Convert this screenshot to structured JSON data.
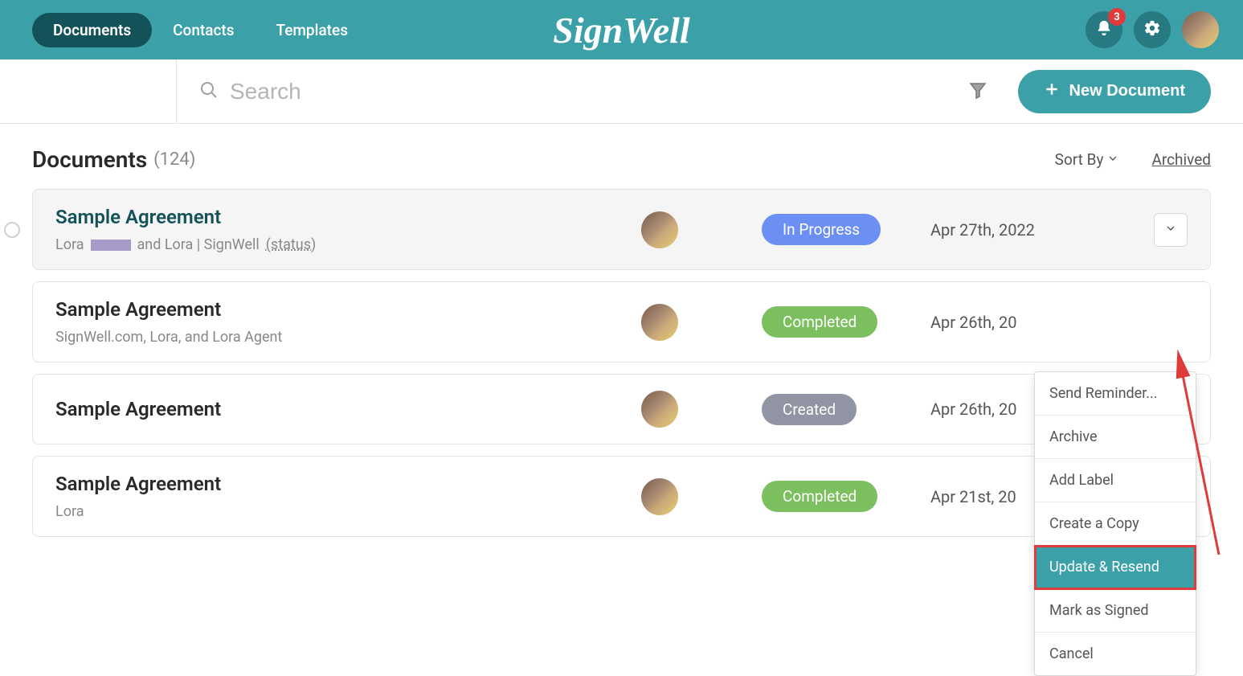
{
  "nav": {
    "items": [
      {
        "label": "Documents",
        "active": true
      },
      {
        "label": "Contacts",
        "active": false
      },
      {
        "label": "Templates",
        "active": false
      }
    ],
    "logo": "SignWell",
    "notifications_count": "3"
  },
  "search": {
    "placeholder": "Search",
    "new_button": "New Document"
  },
  "page": {
    "title": "Documents",
    "count": "(124)",
    "sort_label": "Sort By",
    "archived_label": "Archived"
  },
  "documents": [
    {
      "title": "Sample Agreement",
      "sub_prefix": "Lora",
      "sub_suffix": " and Lora | SignWell ",
      "status_link": "(status)",
      "show_redact": true,
      "status": "In Progress",
      "status_class": "pill-progress",
      "date": "Apr 27th, 2022",
      "selected": true
    },
    {
      "title": "Sample Agreement",
      "sub_prefix": "SignWell.com, Lora, and Lora Agent",
      "sub_suffix": "",
      "status_link": "",
      "show_redact": false,
      "status": "Completed",
      "status_class": "pill-completed",
      "date": "Apr 26th, 20",
      "selected": false
    },
    {
      "title": "Sample Agreement",
      "sub_prefix": "",
      "sub_suffix": "",
      "status_link": "",
      "show_redact": false,
      "status": "Created",
      "status_class": "pill-created",
      "date": "Apr 26th, 20",
      "selected": false
    },
    {
      "title": "Sample Agreement",
      "sub_prefix": "Lora",
      "sub_suffix": "",
      "status_link": "",
      "show_redact": false,
      "status": "Completed",
      "status_class": "pill-completed",
      "date": "Apr 21st, 20",
      "selected": false
    }
  ],
  "menu": {
    "items": [
      {
        "label": "Send Reminder...",
        "highlighted": false
      },
      {
        "label": "Archive",
        "highlighted": false
      },
      {
        "label": "Add Label",
        "highlighted": false
      },
      {
        "label": "Create a Copy",
        "highlighted": false
      },
      {
        "label": "Update & Resend",
        "highlighted": true
      },
      {
        "label": "Mark as Signed",
        "highlighted": false
      },
      {
        "label": "Cancel",
        "highlighted": false
      }
    ]
  }
}
